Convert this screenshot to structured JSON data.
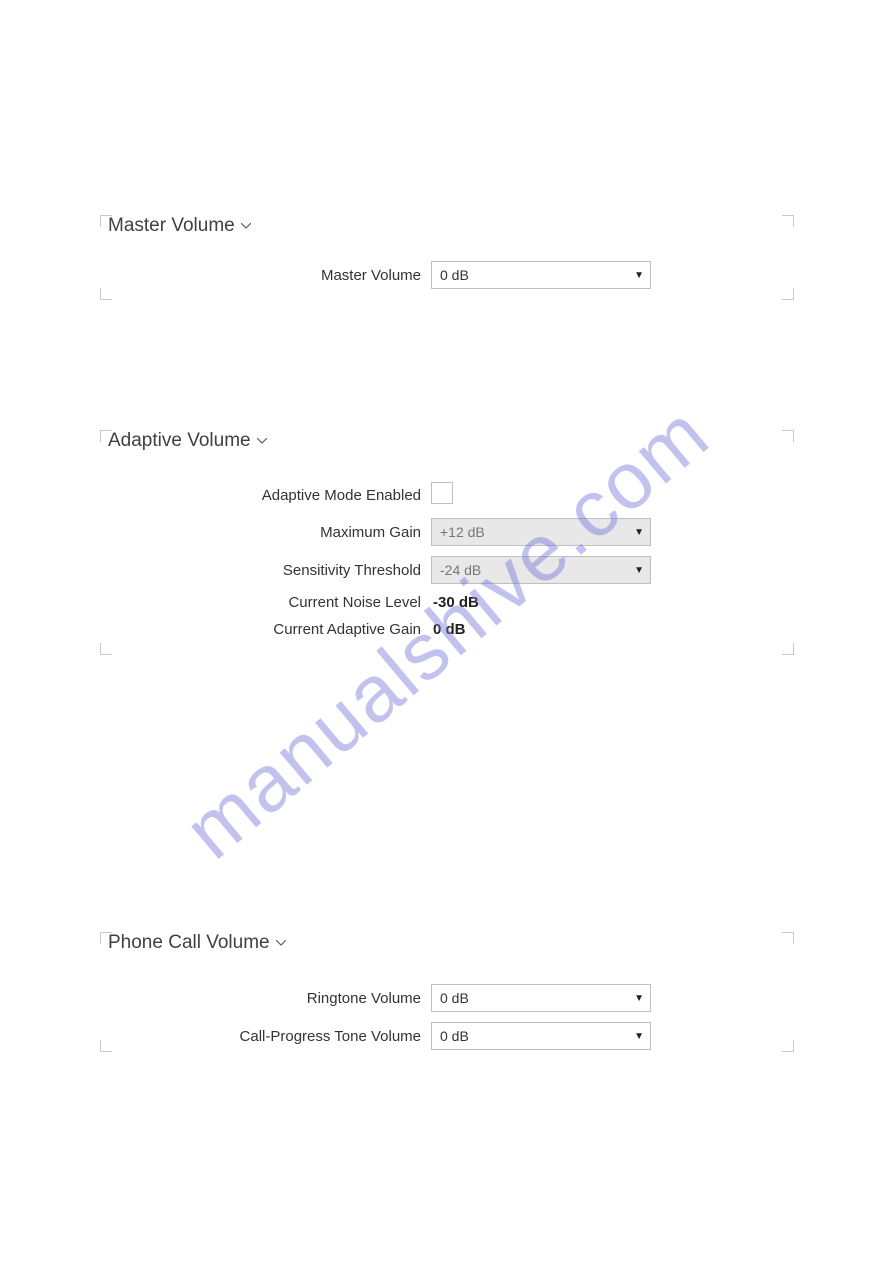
{
  "watermark": "manualshive.com",
  "sections": {
    "master": {
      "title": "Master Volume",
      "master_volume_label": "Master Volume",
      "master_volume_value": "0 dB"
    },
    "adaptive": {
      "title": "Adaptive Volume",
      "mode_enabled_label": "Adaptive Mode Enabled",
      "mode_enabled_checked": false,
      "max_gain_label": "Maximum Gain",
      "max_gain_value": "+12 dB",
      "sensitivity_label": "Sensitivity Threshold",
      "sensitivity_value": "-24 dB",
      "noise_level_label": "Current Noise Level",
      "noise_level_value": "-30 dB",
      "adaptive_gain_label": "Current Adaptive Gain",
      "adaptive_gain_value": "0 dB"
    },
    "phone": {
      "title": "Phone Call Volume",
      "ringtone_label": "Ringtone Volume",
      "ringtone_value": "0 dB",
      "call_progress_label": "Call-Progress Tone Volume",
      "call_progress_value": "0 dB"
    }
  }
}
